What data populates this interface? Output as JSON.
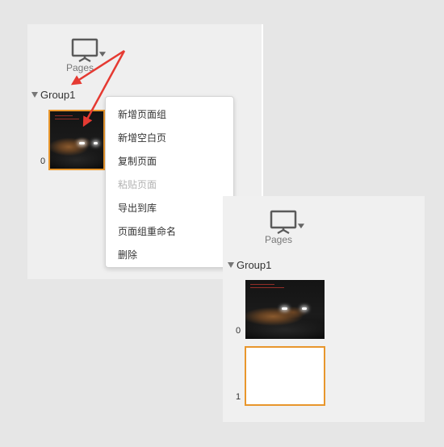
{
  "panel_before": {
    "pages_label": "Pages",
    "group_label": "Group1",
    "pages": [
      {
        "index": "0",
        "selected": true,
        "thumbnail": "dark-car-image"
      }
    ]
  },
  "context_menu": {
    "items": [
      {
        "label": "新增页面组",
        "enabled": true
      },
      {
        "label": "新增空白页",
        "enabled": true
      },
      {
        "label": "复制页面",
        "enabled": true
      },
      {
        "label": "粘贴页面",
        "enabled": false
      },
      {
        "label": "导出到库",
        "enabled": true
      },
      {
        "label": "页面组重命名",
        "enabled": true
      },
      {
        "label": "删除",
        "enabled": true
      }
    ]
  },
  "panel_after": {
    "pages_label": "Pages",
    "group_label": "Group1",
    "pages": [
      {
        "index": "0",
        "selected": false,
        "thumbnail": "dark-car-image"
      },
      {
        "index": "1",
        "selected": true,
        "thumbnail": "blank"
      }
    ]
  },
  "colors": {
    "selection_border": "#e8962c",
    "annotation_arrow": "#e53a32",
    "panel_background": "#efefef",
    "disabled_text": "#b3b3b3"
  },
  "icons": {
    "pages_icon": "presentation-screen-icon",
    "dropdown": "caret-down-icon",
    "group_toggle": "triangle-down-icon"
  }
}
